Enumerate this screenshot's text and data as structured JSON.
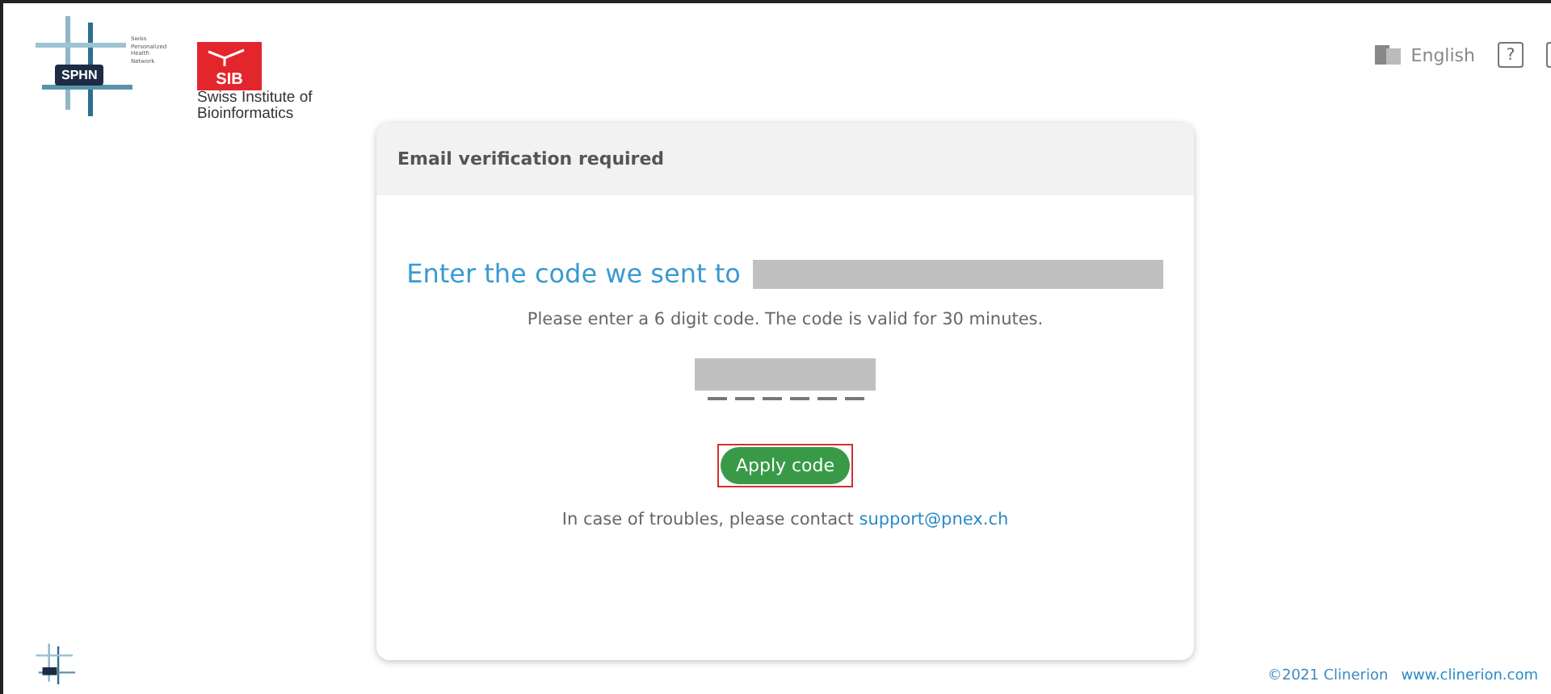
{
  "logos": {
    "sphn_caption": "Swiss Personalized Health Network",
    "sphn_badge": "SPHN",
    "sib_badge": "SIB",
    "sib_caption": "Swiss Institute of Bioinformatics"
  },
  "header": {
    "language": "English",
    "help": "?"
  },
  "card": {
    "title": "Email verification required",
    "heading": "Enter the code we sent to",
    "instruction": "Please enter a 6 digit code. The code is valid for 30 minutes.",
    "button": "Apply code",
    "contact_text": "In case of troubles, please contact",
    "contact_link": "support@pnex.ch"
  },
  "footer": {
    "copyright": "©2021 Clinerion",
    "website": "www.clinerion.com"
  }
}
